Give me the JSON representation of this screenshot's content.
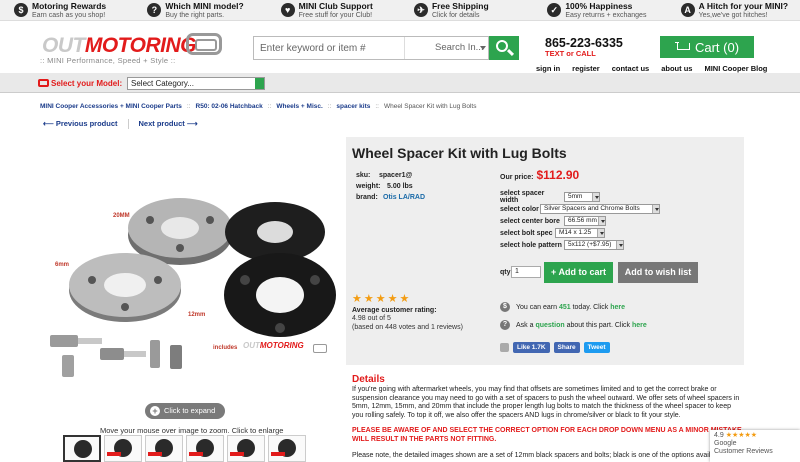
{
  "promo": [
    {
      "icon": "$",
      "icon_name": "dollar-icon",
      "title": "Motoring Rewards",
      "sub": "Earn cash as you shop!"
    },
    {
      "icon": "?",
      "icon_name": "question-icon",
      "title": "Which MINI model?",
      "sub": "Buy the right parts."
    },
    {
      "icon": "♥",
      "icon_name": "club-icon",
      "title": "MINI Club Support",
      "sub": "Free stuff for your Club!"
    },
    {
      "icon": "✈",
      "icon_name": "shipping-icon",
      "title": "Free Shipping",
      "sub": "Click for details"
    },
    {
      "icon": "✓",
      "icon_name": "happiness-icon",
      "title": "100% Happiness",
      "sub": "Easy returns + exchanges"
    },
    {
      "icon": "A",
      "icon_name": "hitch-icon",
      "title": "A Hitch for your MINI?",
      "sub": "Yes,we've got hitches!"
    }
  ],
  "logo": {
    "part1": "OUT",
    "part2": "MOTORING",
    "tagline": ":: MINI Performance, Speed + Style ::"
  },
  "search": {
    "placeholder": "Enter keyword or item #",
    "category": "Search In..."
  },
  "phone": "865-223-6335",
  "text_or_call": "TEXT or CALL",
  "cart": {
    "label": "Cart (0)"
  },
  "header_links": [
    "sign in",
    "register",
    "contact us",
    "about us",
    "MINI Cooper Blog"
  ],
  "model": {
    "label": "Select your Model:",
    "value": "Select Category..."
  },
  "breadcrumb": [
    "MINI Cooper Accessories + MINI Cooper Parts",
    "R50: 02-06 Hatchback",
    "Wheels + Misc.",
    "spacer kits"
  ],
  "breadcrumb_current": "Wheel Spacer Kit with Lug Bolts",
  "breadcrumb_sep": "::",
  "nav": {
    "prev": "⟵ Previous product",
    "next": "Next product ⟶"
  },
  "image": {
    "labels": {
      "l20": "20MM",
      "l6": "6mm",
      "l12": "12mm"
    },
    "includes": "includes",
    "inc_logo_1": "OUT",
    "inc_logo_2": "MOTORING",
    "expand": "Click to expand",
    "zoom_hint": "Move your mouse over image to zoom. Click to enlarge",
    "thumb_count": 6
  },
  "product": {
    "title": "Wheel Spacer Kit with Lug Bolts",
    "sku_label": "sku:",
    "sku": "spacer1@",
    "weight_label": "weight:",
    "weight": "5.00 lbs",
    "brand_label": "brand:",
    "brand": "Otis LA/RAD",
    "price_label": "Our price:",
    "price": "$112.90"
  },
  "options": [
    {
      "label": "select spacer width",
      "value": "5mm"
    },
    {
      "label": "select color",
      "value": "Silver Spacers and Chrome Bolts"
    },
    {
      "label": "select center bore",
      "value": "66.56 mm"
    },
    {
      "label": "select bolt spec",
      "value": "M14 x 1.25"
    },
    {
      "label": "select hole pattern",
      "value": "5x112 (+$7.95)"
    }
  ],
  "qty": {
    "label": "qty",
    "value": "1"
  },
  "buttons": {
    "add_to_cart": "+ Add to cart",
    "wishlist": "Add to wish list"
  },
  "rating": {
    "label": "Average customer rating:",
    "score": "4.98 out of 5",
    "votes": "(based on 448 votes and 1 reviews)",
    "stars": 5
  },
  "earn": {
    "pre": "You can earn",
    "amount": "451",
    "mid": "today. Click",
    "link": "here"
  },
  "ask": {
    "pre": "Ask a",
    "link1": "question",
    "mid": "about this part. Click",
    "link2": "here"
  },
  "social": {
    "fb": "Like 1.7K",
    "share": "Share",
    "tweet": "Tweet"
  },
  "details": {
    "title": "Details",
    "body": "If you're going with aftermarket wheels, you may find that offsets are sometimes limited and to get the correct brake or suspension clearance you may need to go with a set of spacers to push the wheel outward. We offer sets of wheel spacers in 5mm, 12mm, 15mm, and 20mm that include the proper length lug bolts to match the thickness of the wheel spacer to keep you rolling safely. To top it off, we also offer the spacers AND lugs in chrome/silver or black to fit your style.",
    "warning": "PLEASE BE AWARE OF AND SELECT THE CORRECT OPTION FOR EACH DROP DOWN MENU AS A MINOR MISTAKE WILL RESULT IN THE PARTS NOT FITTING.",
    "note": "Please note, the detailed images shown are a set of 12mm black spacers and bolts; black is one of the options availa"
  },
  "google": {
    "score": "4.9",
    "stars": "★★★★★",
    "name": "Google",
    "label": "Customer Reviews"
  },
  "colors": {
    "accent_green": "#2da44e",
    "brand_red": "#e21b1b",
    "link_blue": "#1a3b8a"
  }
}
